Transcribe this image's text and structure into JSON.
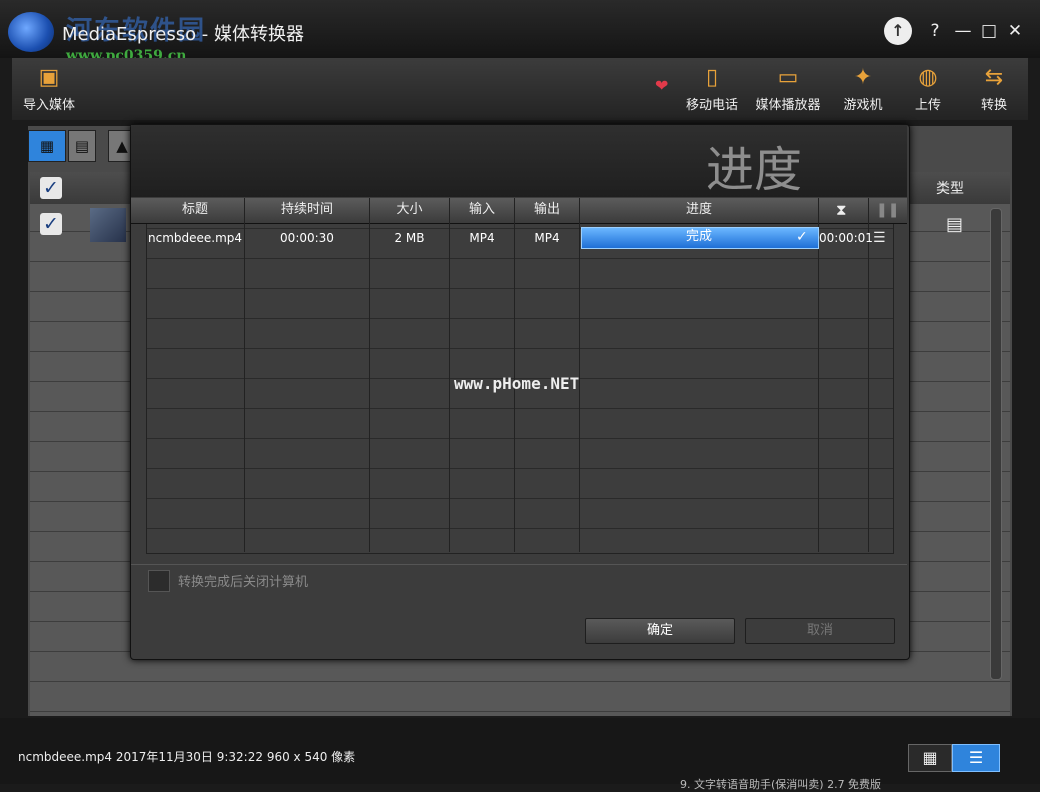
{
  "titlebar": {
    "title": "MediaEspresso - 媒体转换器",
    "watermark": "河东软件园",
    "watermark_url": "www.pc0359.cn",
    "upgrade_icon": "arrow-up-icon",
    "help": "?",
    "minimize": "—",
    "maximize": "□",
    "close": "✕"
  },
  "toolbar": {
    "import": "导入媒体",
    "items": [
      "移动电话",
      "媒体播放器",
      "游戏机",
      "上传",
      "转换"
    ]
  },
  "main": {
    "type_header": "类型"
  },
  "dialog": {
    "title": "进度",
    "columns": [
      "标题",
      "持续时间",
      "大小",
      "输入",
      "输出",
      "进度"
    ],
    "row": {
      "title": "ncmbdeee.mp4",
      "duration": "00:00:30",
      "size": "2 MB",
      "input": "MP4",
      "output": "MP4",
      "progress_text": "完成",
      "progress": 1.0,
      "elapsed": "00:00:01"
    },
    "watermark": "www.pHome.NET",
    "shutdown_label": "转换完成后关闭计算机",
    "ok": "确定",
    "cancel": "取消"
  },
  "statusbar": {
    "text": "ncmbdeee.mp4   2017年11月30日 9:32:22 960 x 540 像素",
    "bottom_strip": "9. 文字转语音助手(保消叫卖) 2.7 免费版"
  },
  "colors": {
    "accent": "#2f84dc",
    "progress": "#1e6fd6",
    "toolbar_icon": "#e8a23a"
  }
}
